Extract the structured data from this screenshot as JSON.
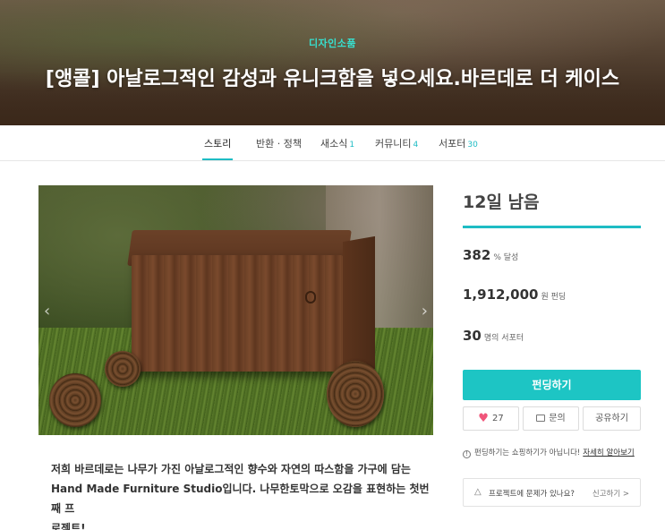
{
  "hero": {
    "category": "디자인소품",
    "title": "[앵콜] 아날로그적인 감성과 유니크함을 넣으세요.바르데로 더 케이스"
  },
  "tabs": [
    {
      "label": "스토리",
      "count": "",
      "active": true
    },
    {
      "label": "반환 · 정책",
      "count": "",
      "active": false
    },
    {
      "label": "새소식",
      "count": "1",
      "active": false
    },
    {
      "label": "커뮤니티",
      "count": "4",
      "active": false
    },
    {
      "label": "서포터",
      "count": "30",
      "active": false
    }
  ],
  "sidebar": {
    "remaining": "12일 남음",
    "percent": {
      "value": "382",
      "unit": "% 달성"
    },
    "amount": {
      "value": "1,912,000",
      "unit": "원 펀딩"
    },
    "supporters": {
      "value": "30",
      "unit": "명의 서포터"
    },
    "fund_button": "펀딩하기",
    "like_count": "27",
    "inquiry_label": "문의",
    "share_label": "공유하기",
    "notice_text": "펀딩하기는 쇼핑하기가 아닙니다!",
    "notice_link": "자세히 알아보기",
    "report_text": "프로젝트에 문제가 있나요?",
    "report_link": "신고하기 >"
  },
  "description": {
    "line1": "저희 바르데로는 나무가 가진 아날로그적인 향수와 자연의 따스함을 가구에 담는",
    "line2": "Hand Made Furniture Studio입니다. 나무한토막으로 오감을 표현하는 첫번째 프",
    "line3": "로젝트!"
  },
  "colors": {
    "accent": "#1dc5c4",
    "heart": "#f0557a"
  }
}
